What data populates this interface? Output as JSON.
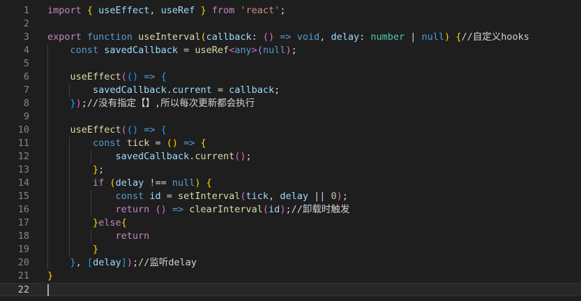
{
  "editor": {
    "current_line": 22
  },
  "lines": [
    {
      "n": "1",
      "tokens": [
        [
          "import ",
          "ctl"
        ],
        [
          "{ ",
          "br1"
        ],
        [
          "useEffect",
          "var"
        ],
        [
          ", ",
          "pun"
        ],
        [
          "useRef",
          "var"
        ],
        [
          " } ",
          "br1"
        ],
        [
          "from ",
          "ctl"
        ],
        [
          "'react'",
          "str"
        ],
        [
          ";",
          "pun"
        ]
      ]
    },
    {
      "n": "2",
      "tokens": []
    },
    {
      "n": "3",
      "tokens": [
        [
          "export ",
          "ctl"
        ],
        [
          "function ",
          "kw"
        ],
        [
          "useInterval",
          "fn"
        ],
        [
          "(",
          "br1"
        ],
        [
          "callback",
          "var"
        ],
        [
          ": ",
          "pun"
        ],
        [
          "()",
          "br2"
        ],
        [
          " => ",
          "kw"
        ],
        [
          "void",
          "kw"
        ],
        [
          ", ",
          "pun"
        ],
        [
          "delay",
          "var"
        ],
        [
          ": ",
          "pun"
        ],
        [
          "number",
          "typ"
        ],
        [
          " | ",
          "pun"
        ],
        [
          "null",
          "kw"
        ],
        [
          ")",
          "br1"
        ],
        [
          " ",
          "pun"
        ],
        [
          "{",
          "br1"
        ],
        [
          "//自定义hooks",
          "cmt"
        ]
      ]
    },
    {
      "n": "4",
      "tokens": [
        [
          "    ",
          "pun"
        ],
        [
          "const ",
          "kw"
        ],
        [
          "savedCallback",
          "var"
        ],
        [
          " = ",
          "pun"
        ],
        [
          "useRef",
          "fn"
        ],
        [
          "<",
          "br2"
        ],
        [
          "any",
          "kw"
        ],
        [
          ">",
          "br2"
        ],
        [
          "(",
          "br2"
        ],
        [
          "null",
          "kw"
        ],
        [
          ")",
          "br2"
        ],
        [
          ";",
          "pun"
        ]
      ]
    },
    {
      "n": "5",
      "tokens": []
    },
    {
      "n": "6",
      "tokens": [
        [
          "    ",
          "pun"
        ],
        [
          "useEffect",
          "fn"
        ],
        [
          "(",
          "br2"
        ],
        [
          "()",
          "br3"
        ],
        [
          " => ",
          "kw"
        ],
        [
          "{",
          "br3"
        ]
      ]
    },
    {
      "n": "7",
      "tokens": [
        [
          "        ",
          "pun"
        ],
        [
          "savedCallback",
          "var"
        ],
        [
          ".",
          "pun"
        ],
        [
          "current",
          "var"
        ],
        [
          " = ",
          "pun"
        ],
        [
          "callback",
          "var"
        ],
        [
          ";",
          "pun"
        ]
      ]
    },
    {
      "n": "8",
      "tokens": [
        [
          "    ",
          "pun"
        ],
        [
          "}",
          "br3"
        ],
        [
          ")",
          "br2"
        ],
        [
          ";//没有指定【】,所以每次更新都会执行",
          "cmt"
        ]
      ]
    },
    {
      "n": "9",
      "tokens": []
    },
    {
      "n": "10",
      "tokens": [
        [
          "    ",
          "pun"
        ],
        [
          "useEffect",
          "fn"
        ],
        [
          "(",
          "br2"
        ],
        [
          "()",
          "br3"
        ],
        [
          " => ",
          "kw"
        ],
        [
          "{",
          "br3"
        ]
      ]
    },
    {
      "n": "11",
      "tokens": [
        [
          "        ",
          "pun"
        ],
        [
          "const ",
          "kw"
        ],
        [
          "tick",
          "fn"
        ],
        [
          " = ",
          "pun"
        ],
        [
          "()",
          "br1"
        ],
        [
          " => ",
          "kw"
        ],
        [
          "{",
          "br1"
        ]
      ]
    },
    {
      "n": "12",
      "tokens": [
        [
          "            ",
          "pun"
        ],
        [
          "savedCallback",
          "var"
        ],
        [
          ".",
          "pun"
        ],
        [
          "current",
          "fn"
        ],
        [
          "()",
          "br2"
        ],
        [
          ";",
          "pun"
        ]
      ]
    },
    {
      "n": "13",
      "tokens": [
        [
          "        ",
          "pun"
        ],
        [
          "}",
          "br1"
        ],
        [
          ";",
          "pun"
        ]
      ]
    },
    {
      "n": "14",
      "tokens": [
        [
          "        ",
          "pun"
        ],
        [
          "if ",
          "ctl"
        ],
        [
          "(",
          "br1"
        ],
        [
          "delay",
          "var"
        ],
        [
          " !== ",
          "op"
        ],
        [
          "null",
          "kw"
        ],
        [
          ")",
          "br1"
        ],
        [
          " ",
          "pun"
        ],
        [
          "{",
          "br1"
        ]
      ]
    },
    {
      "n": "15",
      "tokens": [
        [
          "            ",
          "pun"
        ],
        [
          "const ",
          "kw"
        ],
        [
          "id",
          "var"
        ],
        [
          " = ",
          "pun"
        ],
        [
          "setInterval",
          "fn"
        ],
        [
          "(",
          "br2"
        ],
        [
          "tick",
          "var"
        ],
        [
          ", ",
          "pun"
        ],
        [
          "delay",
          "var"
        ],
        [
          " || ",
          "op"
        ],
        [
          "0",
          "num"
        ],
        [
          ")",
          "br2"
        ],
        [
          ";",
          "pun"
        ]
      ]
    },
    {
      "n": "16",
      "tokens": [
        [
          "            ",
          "pun"
        ],
        [
          "return ",
          "ctl"
        ],
        [
          "()",
          "br2"
        ],
        [
          " => ",
          "kw"
        ],
        [
          "clearInterval",
          "fn"
        ],
        [
          "(",
          "br2"
        ],
        [
          "id",
          "var"
        ],
        [
          ")",
          "br2"
        ],
        [
          ";//卸载时触发",
          "cmt"
        ]
      ]
    },
    {
      "n": "17",
      "tokens": [
        [
          "        ",
          "pun"
        ],
        [
          "}",
          "br1"
        ],
        [
          "else",
          "ctl"
        ],
        [
          "{",
          "br1"
        ]
      ]
    },
    {
      "n": "18",
      "tokens": [
        [
          "            ",
          "pun"
        ],
        [
          "return",
          "ctl"
        ]
      ]
    },
    {
      "n": "19",
      "tokens": [
        [
          "        ",
          "pun"
        ],
        [
          "}",
          "br1"
        ]
      ]
    },
    {
      "n": "20",
      "tokens": [
        [
          "    ",
          "pun"
        ],
        [
          "}",
          "br3"
        ],
        [
          ", ",
          "pun"
        ],
        [
          "[",
          "br3"
        ],
        [
          "delay",
          "var"
        ],
        [
          "]",
          "br3"
        ],
        [
          ")",
          "br2"
        ],
        [
          ";//监听delay",
          "cmt"
        ]
      ]
    },
    {
      "n": "21",
      "tokens": [
        [
          "}",
          "br1"
        ]
      ]
    },
    {
      "n": "22",
      "tokens": []
    }
  ]
}
